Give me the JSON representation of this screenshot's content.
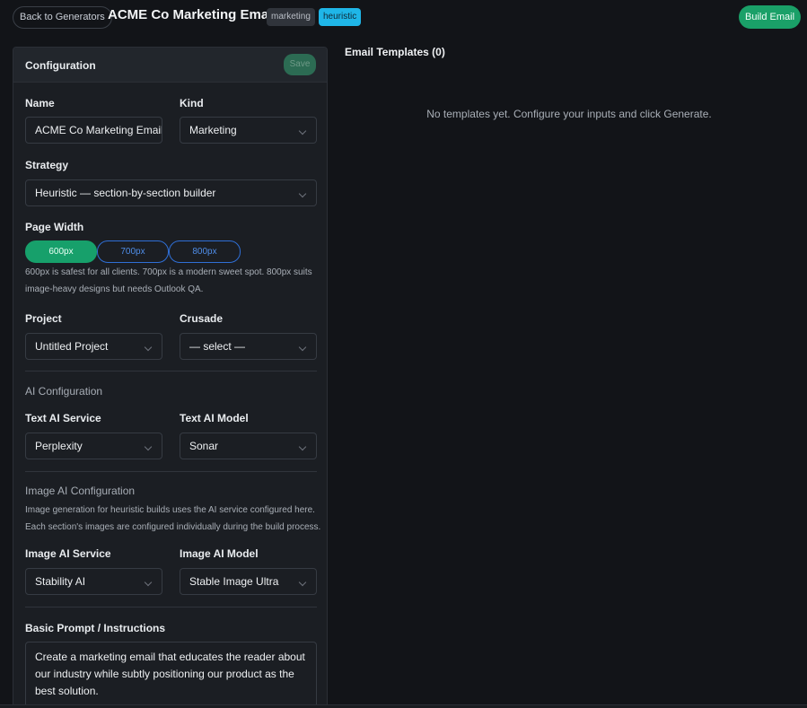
{
  "header": {
    "back_label": "Back to Generators",
    "title": "ACME Co Marketing Emails",
    "badges": [
      "marketing",
      "heuristic"
    ],
    "build_label": "Build Email"
  },
  "config": {
    "title": "Configuration",
    "save_label": "Save",
    "name_label": "Name",
    "name_value": "ACME Co Marketing Emails",
    "kind_label": "Kind",
    "kind_value": "Marketing",
    "strategy_label": "Strategy",
    "strategy_value": "Heuristic — section-by-section builder",
    "page_width_label": "Page Width",
    "widths": [
      "600px",
      "700px",
      "800px"
    ],
    "width_selected": "600px",
    "width_help": "600px is safest for all clients. 700px is a modern sweet spot. 800px suits image-heavy designs but needs Outlook QA.",
    "project_label": "Project",
    "project_value": "Untitled Project",
    "crusade_label": "Crusade",
    "crusade_value": "— select —",
    "ai_section": "AI Configuration",
    "text_service_label": "Text AI Service",
    "text_service_value": "Perplexity",
    "text_model_label": "Text AI Model",
    "text_model_value": "Sonar",
    "image_section": "Image AI Configuration",
    "image_help": "Image generation for heuristic builds uses the AI service configured here. Each section's images are configured individually during the build process.",
    "image_service_label": "Image AI Service",
    "image_service_value": "Stability AI",
    "image_model_label": "Image AI Model",
    "image_model_value": "Stable Image Ultra",
    "prompt_label": "Basic Prompt / Instructions",
    "prompt_value": "Create a marketing email that educates the reader about our industry while subtly positioning our product as the best solution."
  },
  "templates": {
    "title": "Email Templates (0)",
    "empty": "No templates yet. Configure your inputs and click Generate."
  },
  "colors": {
    "accent": "#1aa068",
    "heuristic_badge": "#1fb6e8",
    "width_outline": "#2f6fd6"
  }
}
